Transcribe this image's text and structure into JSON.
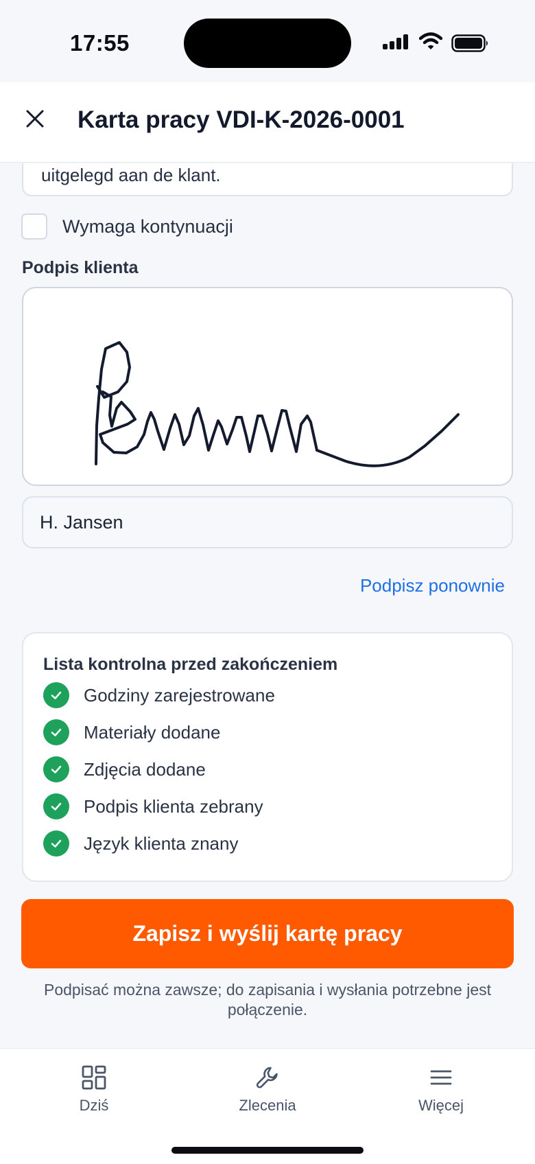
{
  "status_bar": {
    "time": "17:55",
    "icons": [
      "signal-icon",
      "wifi-icon",
      "battery-icon"
    ]
  },
  "header": {
    "title": "Karta pracy VDI-K-2026-0001",
    "close_icon": "close-icon"
  },
  "form": {
    "notes_visible_text": "uitgelegd aan de klant.",
    "follow_up_label": "Wymaga kontynuacji",
    "follow_up_checked": false,
    "signature_label": "Podpis klienta",
    "signer_name": "H. Jansen",
    "resign_label": "Podpisz ponownie"
  },
  "checklist": {
    "title": "Lista kontrolna przed zakończeniem",
    "items": [
      {
        "label": "Godziny zarejestrowane",
        "done": true
      },
      {
        "label": "Materiały dodane",
        "done": true
      },
      {
        "label": "Zdjęcia dodane",
        "done": true
      },
      {
        "label": "Podpis klienta zebrany",
        "done": true
      },
      {
        "label": "Język klienta znany",
        "done": true
      }
    ]
  },
  "actions": {
    "submit_label": "Zapisz i wyślij kartę pracy",
    "hint": "Podpisać można zawsze; do zapisania i wysłania potrzebne jest połączenie."
  },
  "tab_bar": {
    "tabs": [
      {
        "label": "Dziś",
        "icon": "grid-icon"
      },
      {
        "label": "Zlecenia",
        "icon": "wrench-icon"
      },
      {
        "label": "Więcej",
        "icon": "menu-icon"
      }
    ]
  },
  "colors": {
    "accent": "#ff5a00",
    "link": "#1f6fe5",
    "success": "#1ea15a",
    "text": "#1c2434",
    "background": "#f5f7fa"
  }
}
